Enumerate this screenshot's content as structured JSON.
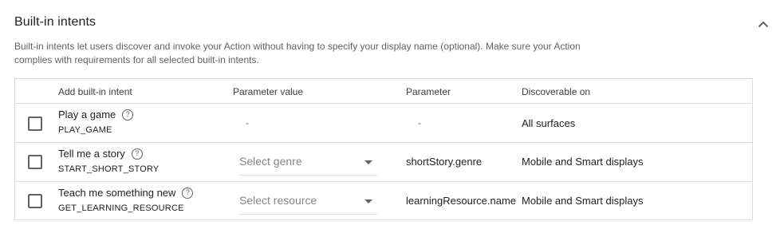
{
  "section": {
    "title": "Built-in intents",
    "description": "Built-in intents let users discover and invoke your Action without having to specify your display name (optional). Make sure your Action complies with requirements for all selected built-in intents.",
    "collapse_icon": "chevron-up-icon"
  },
  "table": {
    "headers": {
      "add": "Add built-in intent",
      "parameter_value": "Parameter value",
      "parameter": "Parameter",
      "discoverable": "Discoverable on"
    },
    "rows": [
      {
        "name": "Play a game",
        "id": "PLAY_GAME",
        "parameter_value": "-",
        "parameter": "-",
        "discoverable": "All surfaces",
        "checked": false
      },
      {
        "name": "Tell me a story",
        "id": "START_SHORT_STORY",
        "select_placeholder": "Select genre",
        "parameter": "shortStory.genre",
        "discoverable": "Mobile and Smart displays",
        "checked": false
      },
      {
        "name": "Teach me something new",
        "id": "GET_LEARNING_RESOURCE",
        "select_placeholder": "Select resource",
        "parameter": "learningResource.name",
        "discoverable": "Mobile and Smart displays",
        "checked": false
      }
    ]
  },
  "icons": {
    "help": "help-circle-icon",
    "dropdown": "dropdown-arrow-icon",
    "checkbox": "checkbox-unchecked-icon"
  }
}
